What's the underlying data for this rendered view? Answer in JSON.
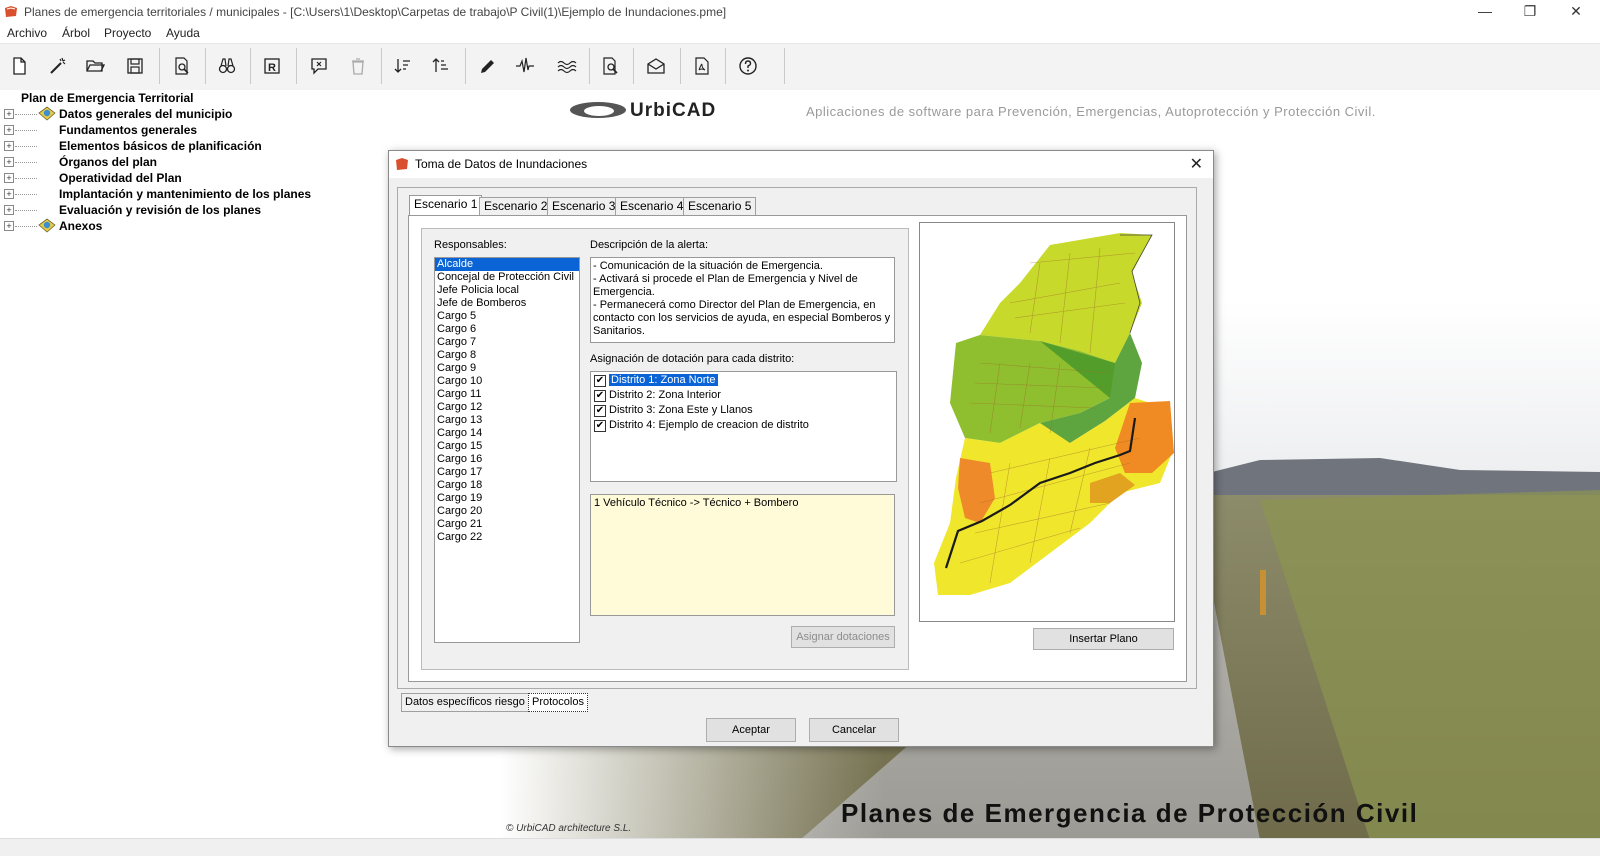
{
  "window": {
    "title": "Planes de emergencia territoriales / municipales - [C:\\Users\\1\\Desktop\\Carpetas de trabajo\\P Civil(1)\\Ejemplo de Inundaciones.pme]",
    "controls": {
      "minimize": "—",
      "restore": "❐",
      "close": "✕"
    }
  },
  "menu": [
    "Archivo",
    "Árbol",
    "Proyecto",
    "Ayuda"
  ],
  "toolbar_icons": [
    "new-icon",
    "wand-icon",
    "open-folder-icon",
    "save-icon",
    "print-preview-icon",
    "binoculars-icon",
    "report-icon",
    "comment-icon",
    "trash-icon",
    "sort-descending-icon",
    "sort-ascending-icon",
    "pencil-icon",
    "seismic-icon",
    "flood-icon",
    "document-search-icon",
    "mail-icon",
    "pdf-icon",
    "help-icon"
  ],
  "tree": {
    "root": "Plan de Emergencia Territorial",
    "items": [
      {
        "label": "Datos generales del municipio",
        "has_icon": true
      },
      {
        "label": "Fundamentos generales",
        "has_icon": false
      },
      {
        "label": "Elementos básicos de planificación",
        "has_icon": false
      },
      {
        "label": "Órganos del plan",
        "has_icon": false
      },
      {
        "label": "Operatividad del Plan",
        "has_icon": false
      },
      {
        "label": "Implantación y mantenimiento de los planes",
        "has_icon": false
      },
      {
        "label": "Evaluación y revisión de los planes",
        "has_icon": false
      },
      {
        "label": "Anexos",
        "has_icon": true
      }
    ]
  },
  "background": {
    "logo": "UrbiCAD",
    "tagline": "Aplicaciones de software para Prevención, Emergencias, Autoprotección y Protección Civil.",
    "banner": "Planes de Emergencia de Protección Civil",
    "credit": "© UrbiCAD architecture S.L."
  },
  "dialog": {
    "title": "Toma de Datos de Inundaciones",
    "close": "✕",
    "tabs": [
      "Escenario 1",
      "Escenario 2",
      "Escenario 3",
      "Escenario 4",
      "Escenario 5"
    ],
    "active_tab": 0,
    "responsables_label": "Responsables:",
    "responsables": [
      "Alcalde",
      "Concejal de Protección Civil",
      "Jefe Policia local",
      "Jefe de Bomberos",
      "Cargo 5",
      "Cargo 6",
      "Cargo 7",
      "Cargo 8",
      "Cargo 9",
      "Cargo 10",
      "Cargo 11",
      "Cargo 12",
      "Cargo 13",
      "Cargo 14",
      "Cargo 15",
      "Cargo 16",
      "Cargo 17",
      "Cargo 18",
      "Cargo 19",
      "Cargo 20",
      "Cargo 21",
      "Cargo 22"
    ],
    "responsable_selected": 0,
    "descripcion_label": "Descripción de la alerta:",
    "descripcion": "- Comunicación de la situación de Emergencia.\n- Activará si procede el Plan de Emergencia y Nivel de Emergencia.\n- Permanecerá como Director del Plan de Emergencia, en contacto con los servicios de ayuda, en especial Bomberos y Sanitarios.",
    "asignacion_label": "Asignación de dotación para cada distrito:",
    "distritos": [
      {
        "label": "Distrito 1: Zona Norte",
        "checked": true
      },
      {
        "label": "Distrito 2: Zona Interior",
        "checked": true
      },
      {
        "label": "Distrito 3: Zona Este y Llanos",
        "checked": true
      },
      {
        "label": "Distrito 4: Ejemplo de creacion de distrito",
        "checked": true
      }
    ],
    "distrito_selected": 0,
    "dotacion": "1 Vehículo Técnico -> Técnico + Bombero",
    "asignar_button": "Asignar dotaciones",
    "insertar_button": "Insertar Plano",
    "bottom_tabs": [
      "Datos específicos riesgo",
      "Protocolos"
    ],
    "bottom_active": 1,
    "aceptar": "Aceptar",
    "cancelar": "Cancelar"
  },
  "colors": {
    "selection": "#0a64d6",
    "notes_bg": "#fffbd9",
    "accent_icon": "#d9502e"
  }
}
